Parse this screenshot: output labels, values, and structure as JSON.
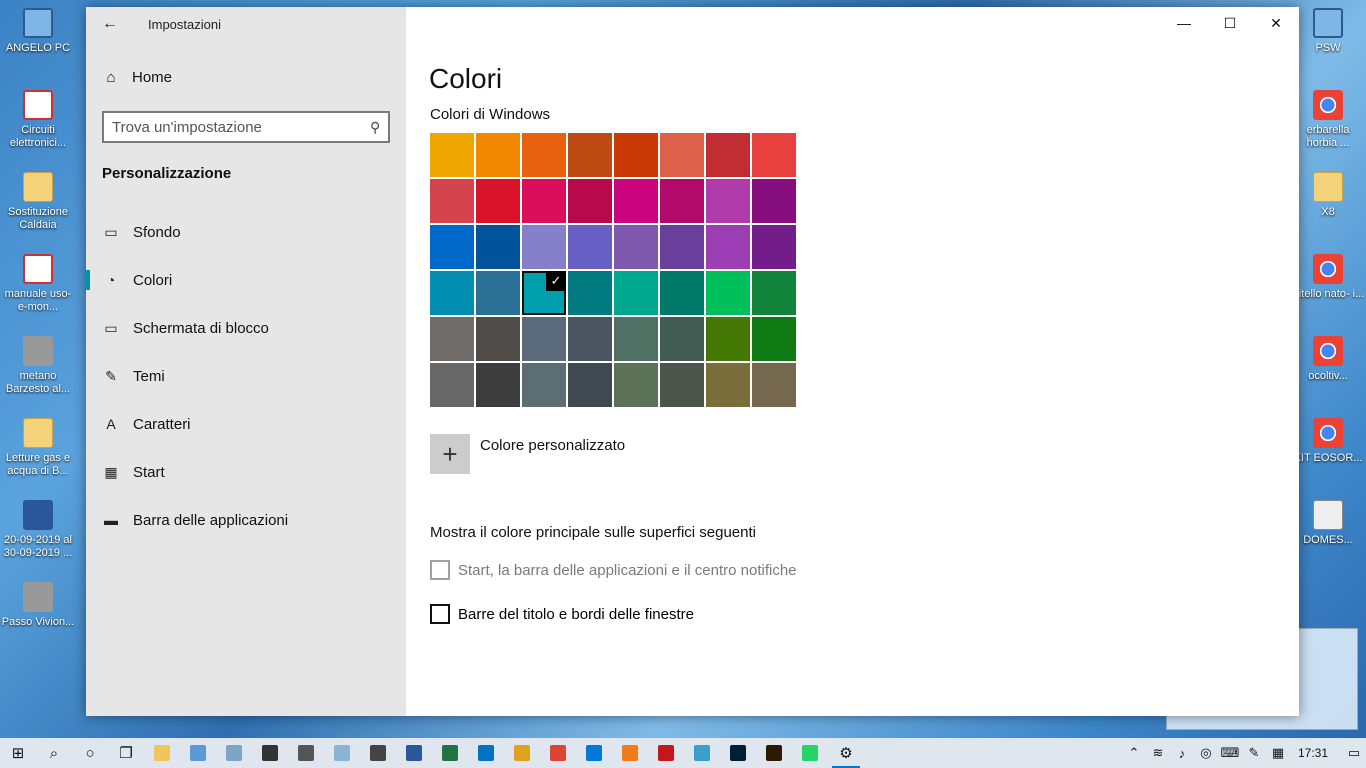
{
  "desktop": {
    "icons_left": [
      {
        "label": "ANGELO PC",
        "type": "pc"
      },
      {
        "label": "Circuiti elettronici...",
        "type": "pdf"
      },
      {
        "label": "Sostituzione Caldaia",
        "type": "folder"
      },
      {
        "label": "manuale uso-e-mon...",
        "type": "pdf"
      },
      {
        "label": "metano Barzesto al...",
        "type": "gray"
      },
      {
        "label": "Letture gas e acqua di B...",
        "type": "folder"
      },
      {
        "label": "20-09-2019 al 30-09-2019 ...",
        "type": "word"
      },
      {
        "label": "Passo Vivion...",
        "type": "gray"
      }
    ],
    "icons_right": [
      {
        "label": "PSW",
        "type": "pc"
      },
      {
        "label": "erbarella horbia ...",
        "type": "chrome"
      },
      {
        "label": "X8",
        "type": "folder"
      },
      {
        "label": "Vitello nato- i...",
        "type": "chrome"
      },
      {
        "label": "ocoltiv...",
        "type": "chrome"
      },
      {
        "label": "KIT EOSOR...",
        "type": "chrome"
      },
      {
        "label": "DOMES...",
        "type": "mail"
      }
    ]
  },
  "window": {
    "app_title": "Impostazioni",
    "controls": {
      "minimize": "—",
      "maximize": "☐",
      "close": "✕"
    }
  },
  "sidebar": {
    "home_label": "Home",
    "search_placeholder": "Trova un'impostazione",
    "section_title": "Personalizzazione",
    "items": [
      {
        "label": "Sfondo",
        "icon": "picture-icon",
        "glyph": "▭"
      },
      {
        "label": "Colori",
        "icon": "palette-icon",
        "glyph": "◔",
        "active": true
      },
      {
        "label": "Schermata di blocco",
        "icon": "monitor-icon",
        "glyph": "▭"
      },
      {
        "label": "Temi",
        "icon": "pen-icon",
        "glyph": "✎"
      },
      {
        "label": "Caratteri",
        "icon": "font-icon",
        "glyph": "A"
      },
      {
        "label": "Start",
        "icon": "start-grid-icon",
        "glyph": "▦"
      },
      {
        "label": "Barra delle applicazioni",
        "icon": "taskbar-icon",
        "glyph": "▬"
      }
    ]
  },
  "content": {
    "title": "Colori",
    "windows_colors_title": "Colori di Windows",
    "swatches": [
      "#f0a600",
      "#f08800",
      "#e8610e",
      "#bc4a12",
      "#c93a06",
      "#dd604a",
      "#c22d34",
      "#e8403e",
      "#d4434e",
      "#d91329",
      "#da0d5a",
      "#b80a4a",
      "#cd0480",
      "#b20a6a",
      "#b13baa",
      "#860e7f",
      "#0069c9",
      "#00549c",
      "#8580c9",
      "#6860c5",
      "#7e59ad",
      "#6a3f9c",
      "#9c3eb3",
      "#731d8a",
      "#008db0",
      "#2a7195",
      "#009fad",
      "#007a7e",
      "#00a88f",
      "#007a68",
      "#00c05c",
      "#11833b",
      "#706c6a",
      "#504c4a",
      "#5c6b7c",
      "#4b5562",
      "#4f7163",
      "#435c53",
      "#447804",
      "#107a14",
      "#686868",
      "#3d3d3d",
      "#5c6d73",
      "#404850",
      "#5b7258",
      "#4b5549",
      "#786d3b",
      "#75684f"
    ],
    "selected_index": 26,
    "custom_color_label": "Colore personalizzato",
    "surfaces_title": "Mostra il colore principale sulle superfici seguenti",
    "checkbox_start": "Start, la barra delle applicazioni e il centro notifiche",
    "checkbox_titlebars": "Barre del titolo e bordi delle finestre"
  },
  "taskbar": {
    "apps": [
      {
        "name": "file-explorer",
        "color": "#f2c55c"
      },
      {
        "name": "control-panel",
        "color": "#5b9bd5"
      },
      {
        "name": "photos",
        "color": "#7aa7c7"
      },
      {
        "name": "sticky-notes",
        "color": "#333333"
      },
      {
        "name": "camera",
        "color": "#555555"
      },
      {
        "name": "notepad",
        "color": "#8ab4d6"
      },
      {
        "name": "calculator",
        "color": "#444444"
      },
      {
        "name": "word",
        "color": "#2b579a"
      },
      {
        "name": "excel",
        "color": "#217346"
      },
      {
        "name": "outlook",
        "color": "#0072c6"
      },
      {
        "name": "photo-viewer",
        "color": "#e0a020"
      },
      {
        "name": "chrome",
        "color": "#db4437"
      },
      {
        "name": "edge",
        "color": "#0078d7"
      },
      {
        "name": "media-player",
        "color": "#f27a1a"
      },
      {
        "name": "acrobat",
        "color": "#c4161c"
      },
      {
        "name": "snipping",
        "color": "#3aa0c8"
      },
      {
        "name": "photoshop",
        "color": "#001d34"
      },
      {
        "name": "bridge",
        "color": "#2b1a00"
      },
      {
        "name": "whatsapp",
        "color": "#25d366"
      }
    ],
    "clock": "17:31"
  }
}
